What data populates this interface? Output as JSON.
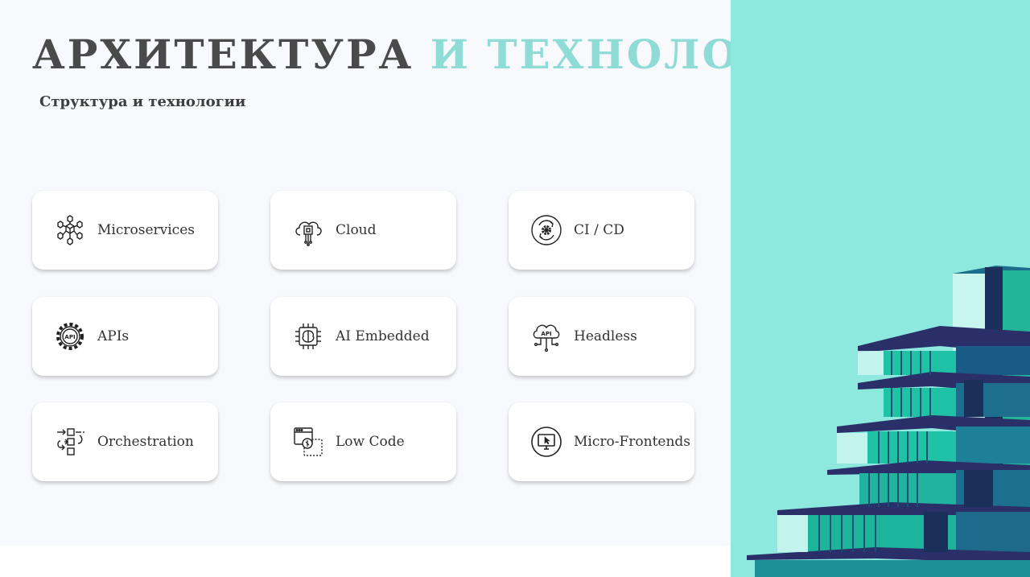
{
  "header": {
    "title_part1": "АРХИТЕКТУРА",
    "title_part2": "И ТЕХНОЛОГИИ",
    "subtitle": "Структура и технологии"
  },
  "cards": [
    {
      "label": "Microservices",
      "icon": "microservices-icon"
    },
    {
      "label": "Cloud",
      "icon": "cloud-chip-icon"
    },
    {
      "label": "CI / CD",
      "icon": "ci-cd-gear-icon"
    },
    {
      "label": "APIs",
      "icon": "api-gear-icon"
    },
    {
      "label": "AI Embedded",
      "icon": "ai-chip-icon"
    },
    {
      "label": "Headless",
      "icon": "api-cloud-icon"
    },
    {
      "label": "Orchestration",
      "icon": "orchestration-flow-icon"
    },
    {
      "label": "Low Code",
      "icon": "low-code-window-icon"
    },
    {
      "label": "Micro-Frontends",
      "icon": "monitor-cursor-icon"
    }
  ],
  "colors": {
    "title_dark": "#4a4a4a",
    "title_accent": "#8fdcd6",
    "panel_background": "#8de8dd",
    "slide_background": "#f8f9fd"
  }
}
